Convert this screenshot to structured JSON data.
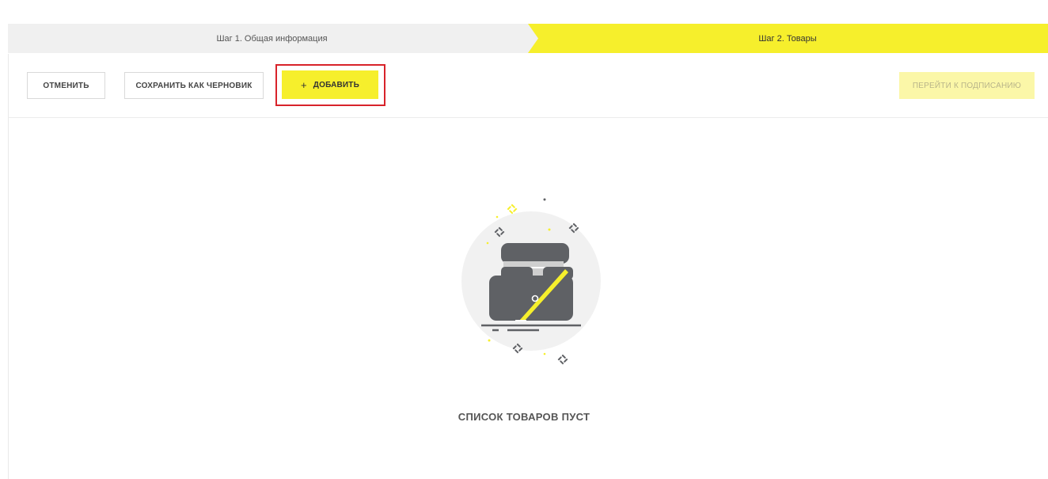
{
  "stepper": {
    "step1_label": "Шаг 1. Общая информация",
    "step2_label": "Шаг 2. Товары"
  },
  "toolbar": {
    "cancel_label": "ОТМЕНИТЬ",
    "save_draft_label": "СОХРАНИТЬ КАК ЧЕРНОВИК",
    "add_label": "ДОБАВИТЬ",
    "add_icon": "plus-icon",
    "sign_label": "ПЕРЕЙТИ К ПОДПИСАНИЮ"
  },
  "empty_state": {
    "icon": "empty-box-icon",
    "message": "СПИСОК ТОВАРОВ ПУСТ"
  },
  "colors": {
    "accent": "#f6ef2c",
    "accent_disabled": "#fbf7a8",
    "highlight": "#d8232a",
    "icon_dark": "#5f6165"
  }
}
